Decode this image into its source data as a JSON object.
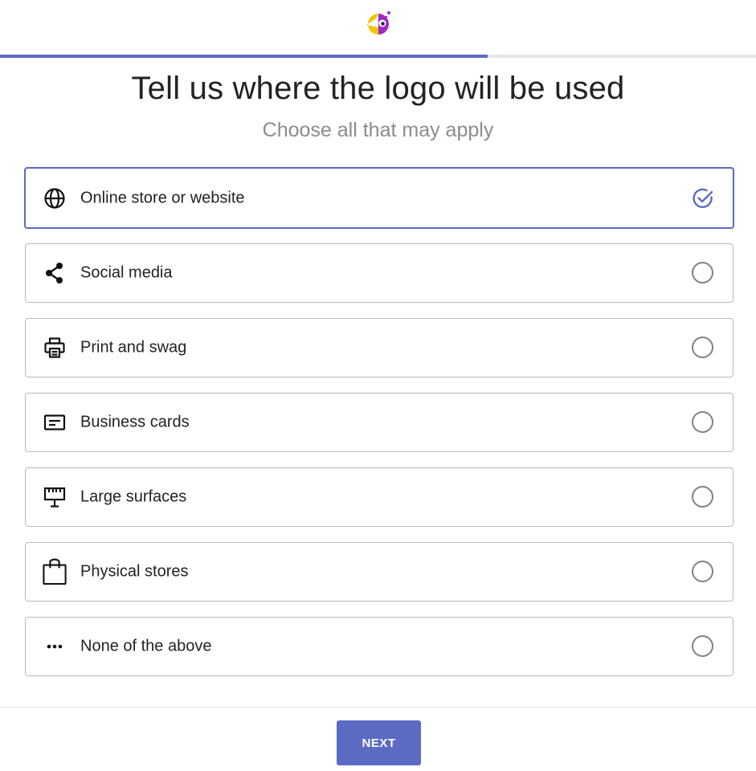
{
  "header": {
    "logo_icon": "brand-logo-icon"
  },
  "progress": {
    "fraction": 0.645,
    "fill_color": "#5c6ac4",
    "track_color": "#e6e7e8"
  },
  "main": {
    "title": "Tell us where the logo will be used",
    "subtitle": "Choose all that may apply"
  },
  "options": [
    {
      "label": "Online store or website",
      "icon": "globe-icon",
      "selected": true
    },
    {
      "label": "Social media",
      "icon": "share-icon",
      "selected": false
    },
    {
      "label": "Print and swag",
      "icon": "printer-icon",
      "selected": false
    },
    {
      "label": "Business cards",
      "icon": "business-card-icon",
      "selected": false
    },
    {
      "label": "Large surfaces",
      "icon": "billboard-icon",
      "selected": false
    },
    {
      "label": "Physical stores",
      "icon": "shopping-bag-icon",
      "selected": false
    },
    {
      "label": "None of the above",
      "icon": "more-dots-icon",
      "selected": false
    }
  ],
  "footer": {
    "next_label": "NEXT"
  },
  "colors": {
    "accent": "#5c6ac4",
    "text": "#212326",
    "muted": "#8a8c8e"
  }
}
